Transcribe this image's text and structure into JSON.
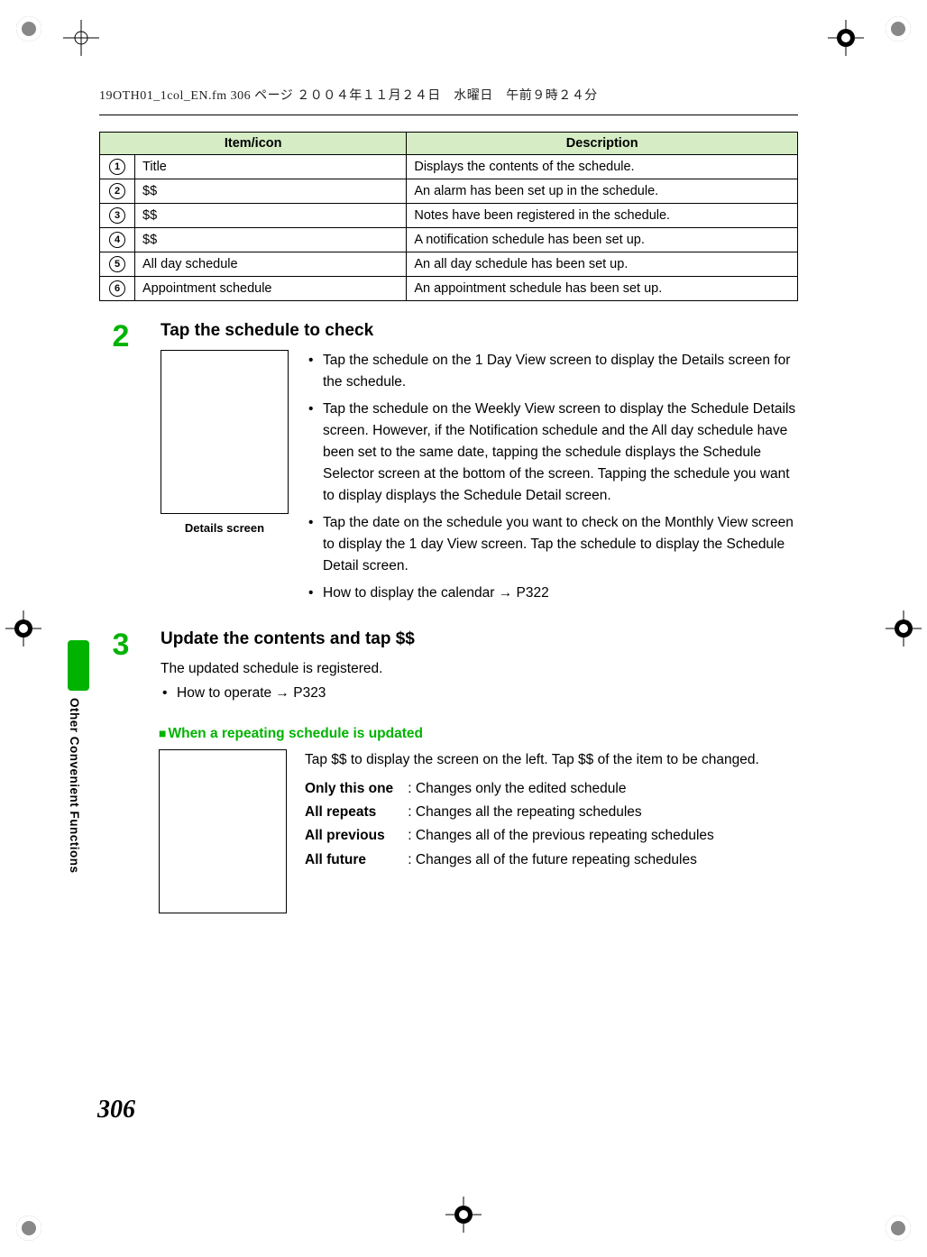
{
  "header": {
    "running": "19OTH01_1col_EN.fm  306 ページ  ２００４年１１月２４日　水曜日　午前９時２４分"
  },
  "table": {
    "headers": {
      "item": "Item/icon",
      "desc": "Description"
    },
    "rows": [
      {
        "n": "1",
        "item": "Title",
        "desc": "Displays the contents of the schedule."
      },
      {
        "n": "2",
        "item": "$$",
        "desc": "An alarm has been set up in the schedule."
      },
      {
        "n": "3",
        "item": "$$",
        "desc": "Notes have been registered in the schedule."
      },
      {
        "n": "4",
        "item": "$$",
        "desc": "A notification schedule has been set up."
      },
      {
        "n": "5",
        "item": "All day schedule",
        "desc": "An all day schedule has been set up."
      },
      {
        "n": "6",
        "item": "Appointment schedule",
        "desc": "An appointment schedule has been set up."
      }
    ]
  },
  "step2": {
    "num": "2",
    "title": "Tap the schedule to check",
    "caption": "Details screen",
    "bullets": [
      "Tap the schedule on the 1 Day View screen to display the Details screen for the schedule.",
      "Tap the schedule on the Weekly View screen to display the Schedule Details screen. However, if the Notification schedule and the All day schedule have been set to the same date, tapping the schedule displays the Schedule Selector screen at the bottom of the screen. Tapping the schedule you want to display displays the Schedule Detail screen.",
      "Tap the date on the schedule you want to check on the Monthly View screen to display the 1 day View screen. Tap the schedule to display the Schedule Detail screen.",
      "How to display the calendar → P322"
    ]
  },
  "step3": {
    "num": "3",
    "title": "Update the contents and tap $$",
    "line1": "The updated schedule is registered.",
    "line2": "How to operate → P323"
  },
  "repeat": {
    "heading": "When a repeating schedule is updated",
    "intro": "Tap $$ to display the screen on the left. Tap $$ of the item to be changed.",
    "defs": [
      {
        "label": "Only this one",
        "text": "Changes only the edited schedule"
      },
      {
        "label": "All repeats",
        "text": "Changes all the repeating schedules"
      },
      {
        "label": "All previous",
        "text": "Changes all of the previous repeating schedules"
      },
      {
        "label": "All future",
        "text": "Changes all of the future repeating schedules"
      }
    ]
  },
  "side": {
    "tabtext": "Other Convenient Functions"
  },
  "pagenum": "306"
}
